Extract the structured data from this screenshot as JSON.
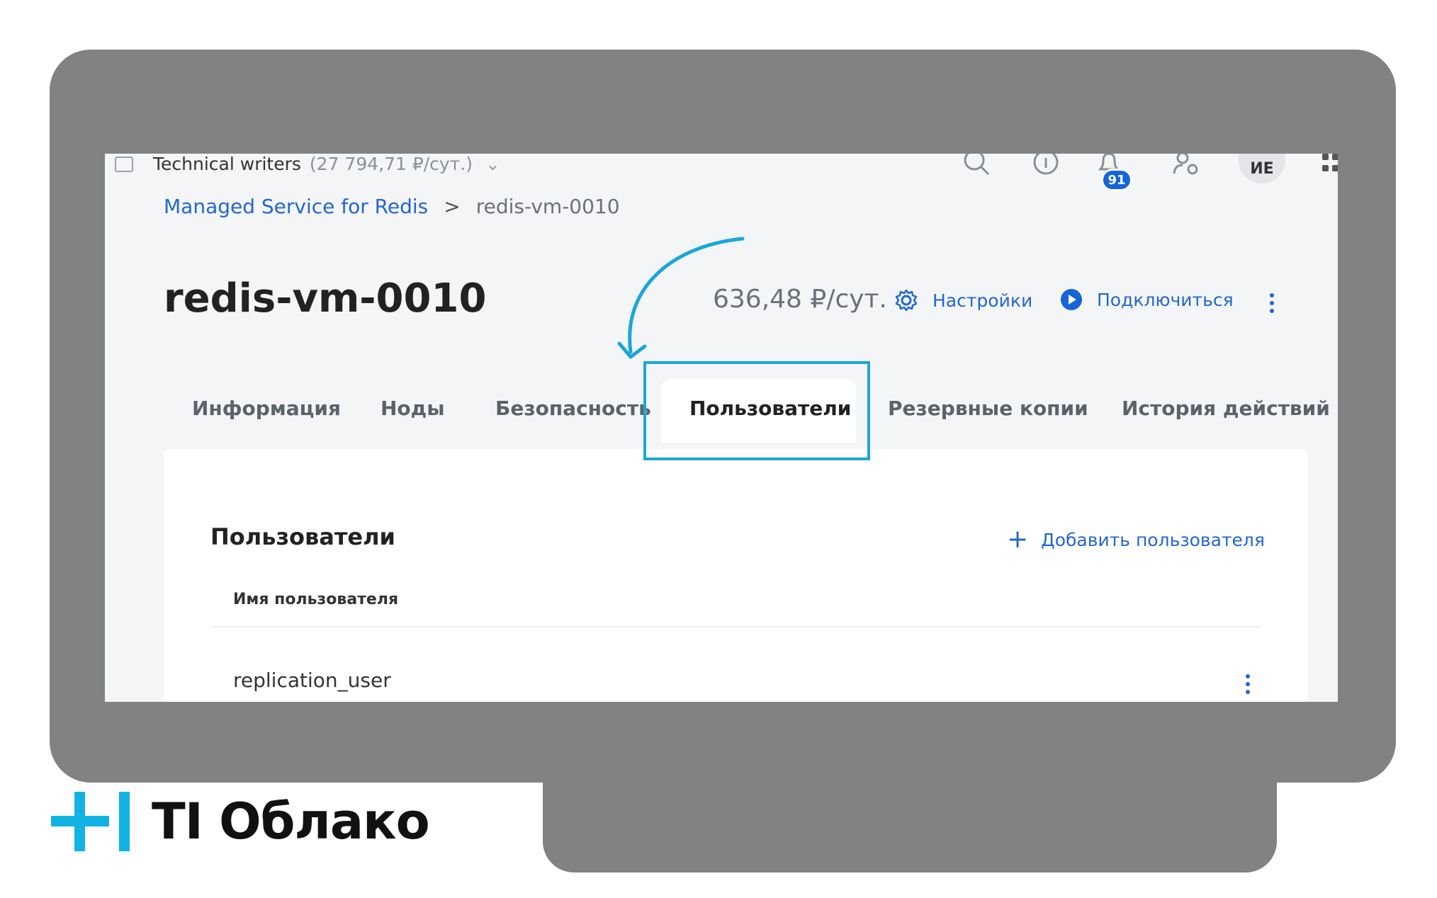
{
  "topbar": {
    "workspace_name": "Technical writers",
    "workspace_price": "(27 794,71 ₽/сут.)",
    "notifications_count": "91",
    "avatar_initials": "ИЕ"
  },
  "breadcrumb": {
    "service": "Managed Service for Redis",
    "current": "redis-vm-0010"
  },
  "header": {
    "title": "redis-vm-0010",
    "price": "636,48 ₽/сут.",
    "settings_label": "Настройки",
    "connect_label": "Подключиться"
  },
  "tabs": [
    {
      "label": "Информация"
    },
    {
      "label": "Ноды"
    },
    {
      "label": "Безопасность"
    },
    {
      "label": "Пользователи",
      "active": true
    },
    {
      "label": "Резервные копии"
    },
    {
      "label": "История действий"
    }
  ],
  "users_panel": {
    "title": "Пользователи",
    "add_label": "Добавить пользователя",
    "column_header": "Имя пользователя",
    "rows": [
      {
        "name": "replication_user"
      }
    ]
  },
  "logo": {
    "text": "TI Облако"
  },
  "colors": {
    "accent": "#2366d1",
    "highlight": "#1ba6da",
    "frame": "#828282",
    "logo_mark": "#12b3e3"
  }
}
